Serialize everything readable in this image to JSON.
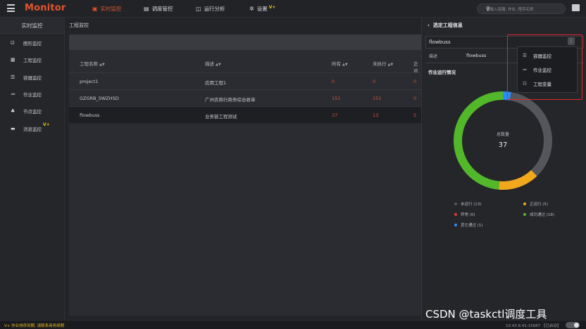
{
  "header": {
    "title": "Monitor",
    "nav": [
      {
        "label": "实时监控",
        "icon": "monitor-icon",
        "active": true
      },
      {
        "label": "调度管控",
        "icon": "calendar-icon"
      },
      {
        "label": "运行分析",
        "icon": "analysis-icon"
      },
      {
        "label": "设置",
        "icon": "gear-icon",
        "badge": "V+"
      }
    ],
    "search_placeholder": "请输入容器, 作业, 程序名称"
  },
  "sidebar": {
    "title": "实时监控",
    "items": [
      {
        "label": "图形监控",
        "icon": "chart-monitor-icon"
      },
      {
        "label": "工程监控",
        "icon": "project-icon"
      },
      {
        "label": "容器监控",
        "icon": "container-icon"
      },
      {
        "label": "作业监控",
        "icon": "job-list-icon"
      },
      {
        "label": "节点监控",
        "icon": "node-tree-icon"
      },
      {
        "label": "消息监控",
        "icon": "message-icon",
        "badge": "V+"
      }
    ]
  },
  "main": {
    "breadcrumb": "工程监控",
    "table": {
      "columns": [
        "工程名称",
        "描述",
        "所有",
        "未执行",
        "正运"
      ],
      "rows": [
        {
          "name": "project1",
          "desc": "应用工程1",
          "all": "0",
          "pending": "0",
          "running": "0"
        },
        {
          "name": "GZGRB_SWZHSD",
          "desc": "广州农商行商务综合收单",
          "all": "151",
          "pending": "151",
          "running": "0"
        },
        {
          "name": "flowbuss",
          "desc": "业务链工程测试",
          "all": "37",
          "pending": "13",
          "running": "5"
        }
      ]
    }
  },
  "right_panel": {
    "title": "选定工程信息",
    "project": "flowbuss",
    "desc_label": "描述",
    "desc_value": "flowbuss",
    "section_title": "作业运行情况",
    "center_label": "总数量",
    "center_value": "37",
    "menu": [
      {
        "label": "容器监控",
        "icon": "container-icon"
      },
      {
        "label": "作业监控",
        "icon": "job-list-icon"
      },
      {
        "label": "工程变量",
        "icon": "variables-icon"
      }
    ]
  },
  "chart_data": {
    "type": "pie",
    "categories": [
      "未运行",
      "正运行",
      "异常",
      "成功通过",
      "其它通过"
    ],
    "values": [
      13,
      5,
      0,
      18,
      1
    ],
    "legend": [
      "未运行 (13)",
      "正运行 (5)",
      "异常 (0)",
      "成功通过 (18)",
      "其它通过 (1)"
    ],
    "colors": [
      "#55565b",
      "#f2a81d",
      "#e33b2e",
      "#52b82a",
      "#2d8cf0"
    ]
  },
  "footer": {
    "left_text": "V+ 作业排序到期, 请联系商务续期",
    "right_text": "10.43.8.41:15687 【已启动】"
  },
  "watermark": "CSDN @taskctl调度工具"
}
